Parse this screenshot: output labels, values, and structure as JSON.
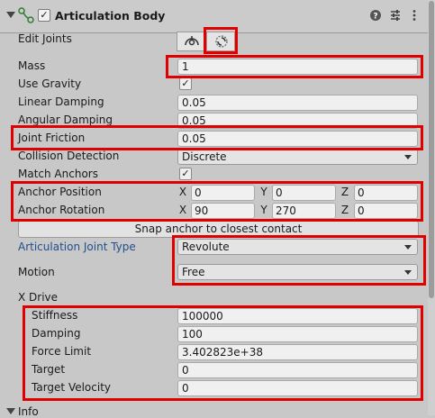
{
  "header": {
    "title": "Articulation Body",
    "enabled_mark": "✓"
  },
  "edit_joints": {
    "label": "Edit Joints"
  },
  "mass": {
    "label": "Mass",
    "value": "1"
  },
  "use_gravity": {
    "label": "Use Gravity",
    "mark": "✓"
  },
  "linear_damping": {
    "label": "Linear Damping",
    "value": "0.05"
  },
  "angular_damping": {
    "label": "Angular Damping",
    "value": "0.05"
  },
  "joint_friction": {
    "label": "Joint Friction",
    "value": "0.05"
  },
  "collision_detection": {
    "label": "Collision Detection",
    "value": "Discrete"
  },
  "match_anchors": {
    "label": "Match Anchors",
    "mark": "✓"
  },
  "anchor_position": {
    "label": "Anchor Position",
    "x_label": "X",
    "y_label": "Y",
    "z_label": "Z",
    "x": "0",
    "y": "0",
    "z": "0"
  },
  "anchor_rotation": {
    "label": "Anchor Rotation",
    "x_label": "X",
    "y_label": "Y",
    "z_label": "Z",
    "x": "90",
    "y": "270",
    "z": "0"
  },
  "snap_button": {
    "label": "Snap anchor to closest contact"
  },
  "joint_type": {
    "label": "Articulation Joint Type",
    "value": "Revolute"
  },
  "motion": {
    "label": "Motion",
    "value": "Free"
  },
  "x_drive": {
    "label": "X Drive",
    "stiffness": {
      "label": "Stiffness",
      "value": "100000"
    },
    "damping": {
      "label": "Damping",
      "value": "100"
    },
    "force_limit": {
      "label": "Force Limit",
      "value": "3.402823e+38"
    },
    "target": {
      "label": "Target",
      "value": "0"
    },
    "target_velocity": {
      "label": "Target Velocity",
      "value": "0"
    }
  },
  "info_section": {
    "label": "Info"
  },
  "colors": {
    "highlight": "#e00000",
    "joint_type_label": "#1f4f8f",
    "background": "#c8c8c8"
  }
}
